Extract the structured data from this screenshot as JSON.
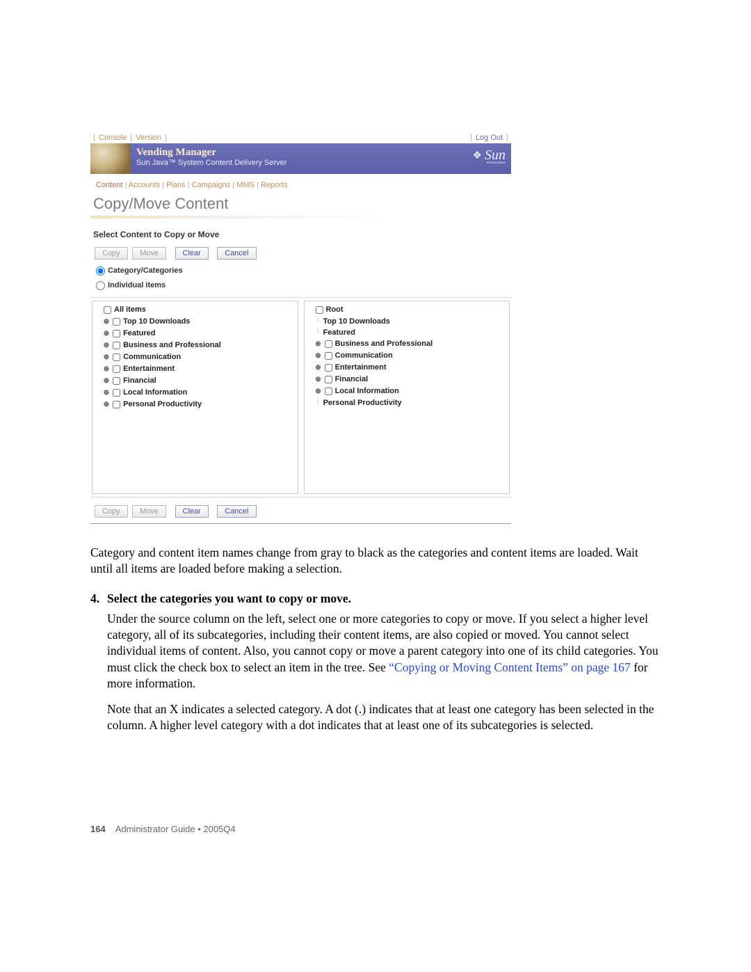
{
  "top_nav": {
    "console": "Console",
    "version": "Version",
    "logout": "Log Out"
  },
  "banner": {
    "title": "Vending Manager",
    "subtitle": "Sun Java™ System Content Delivery Server",
    "logo_text": "Sun",
    "logo_sub": "microsystems"
  },
  "tabs": [
    "Content",
    "Accounts",
    "Plans",
    "Campaigns",
    "MMS",
    "Reports"
  ],
  "page_title": "Copy/Move Content",
  "section_label": "Select Content to Copy or Move",
  "buttons": {
    "copy": "Copy",
    "move": "Move",
    "clear": "Clear",
    "cancel": "Cancel"
  },
  "radios": {
    "categories": "Category/Categories",
    "items": "Individual items"
  },
  "left_tree": {
    "root": "All items",
    "children": [
      "Top 10 Downloads",
      "Featured",
      "Business and Professional",
      "Communication",
      "Entertainment",
      "Financial",
      "Local Information",
      "Personal Productivity"
    ]
  },
  "right_tree": {
    "root": "Root",
    "children": [
      {
        "label": "Top 10 Downloads",
        "expandable": false,
        "checkbox": false
      },
      {
        "label": "Featured",
        "expandable": false,
        "checkbox": false
      },
      {
        "label": "Business and Professional",
        "expandable": true,
        "checkbox": true
      },
      {
        "label": "Communication",
        "expandable": true,
        "checkbox": true
      },
      {
        "label": "Entertainment",
        "expandable": true,
        "checkbox": true
      },
      {
        "label": "Financial",
        "expandable": true,
        "checkbox": true
      },
      {
        "label": "Local Information",
        "expandable": true,
        "checkbox": true
      },
      {
        "label": "Personal Productivity",
        "expandable": false,
        "checkbox": false
      }
    ]
  },
  "body": {
    "p1": "Category and content item names change from gray to black as the categories and content items are loaded. Wait until all items are loaded before making a selection.",
    "step_num": "4.",
    "step_title": "Select the categories you want to copy or move.",
    "p2a": "Under the source column on the left, select one or more categories to copy or move. If you select a higher level category, all of its subcategories, including their content items, are also copied or moved. You cannot select individual items of content. Also, you cannot copy or move a parent category into one of its child categories. You must click the check box to select an item in the tree. See ",
    "link": "“Copying or Moving Content Items” on page 167",
    "p2b": " for more information.",
    "p3": "Note that an X indicates a selected category. A dot (.) indicates that at least one category has been selected in the column. A higher level category with a dot indicates that at least one of its subcategories is selected."
  },
  "footer": {
    "page_number": "164",
    "label": "Administrator Guide • 2005Q4"
  }
}
